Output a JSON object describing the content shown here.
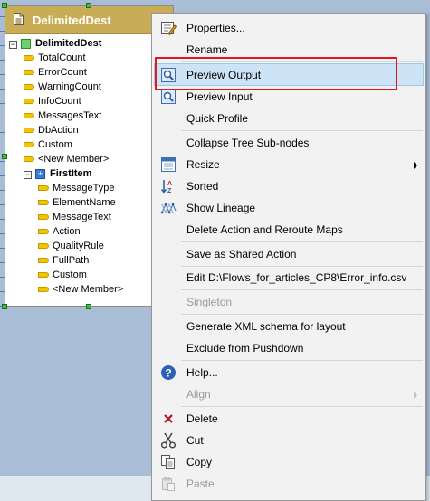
{
  "node": {
    "title": "DelimitedDest",
    "root": "DelimitedDest",
    "fields": [
      "TotalCount",
      "ErrorCount",
      "WarningCount",
      "InfoCount",
      "MessagesText",
      "DbAction",
      "Custom",
      "<New Member>"
    ],
    "subnode": "FirstItem",
    "subfields": [
      "MessageType",
      "ElementName",
      "MessageText",
      "Action",
      "QualityRule",
      "FullPath",
      "Custom",
      "<New Member>"
    ]
  },
  "menu": {
    "properties": "Properties...",
    "rename": "Rename",
    "preview_output": "Preview Output",
    "preview_input": "Preview Input",
    "quick_profile": "Quick Profile",
    "collapse": "Collapse Tree Sub-nodes",
    "resize": "Resize",
    "sorted": "Sorted",
    "show_lineage": "Show Lineage",
    "delete_action": "Delete Action and Reroute Maps",
    "save_shared": "Save as Shared Action",
    "edit_file": "Edit D:\\Flows_for_articles_CP8\\Error_info.csv",
    "singleton": "Singleton",
    "generate_xml": "Generate XML schema for layout",
    "exclude": "Exclude from Pushdown",
    "help": "Help...",
    "align": "Align",
    "delete": "Delete",
    "cut": "Cut",
    "copy": "Copy",
    "paste": "Paste"
  }
}
